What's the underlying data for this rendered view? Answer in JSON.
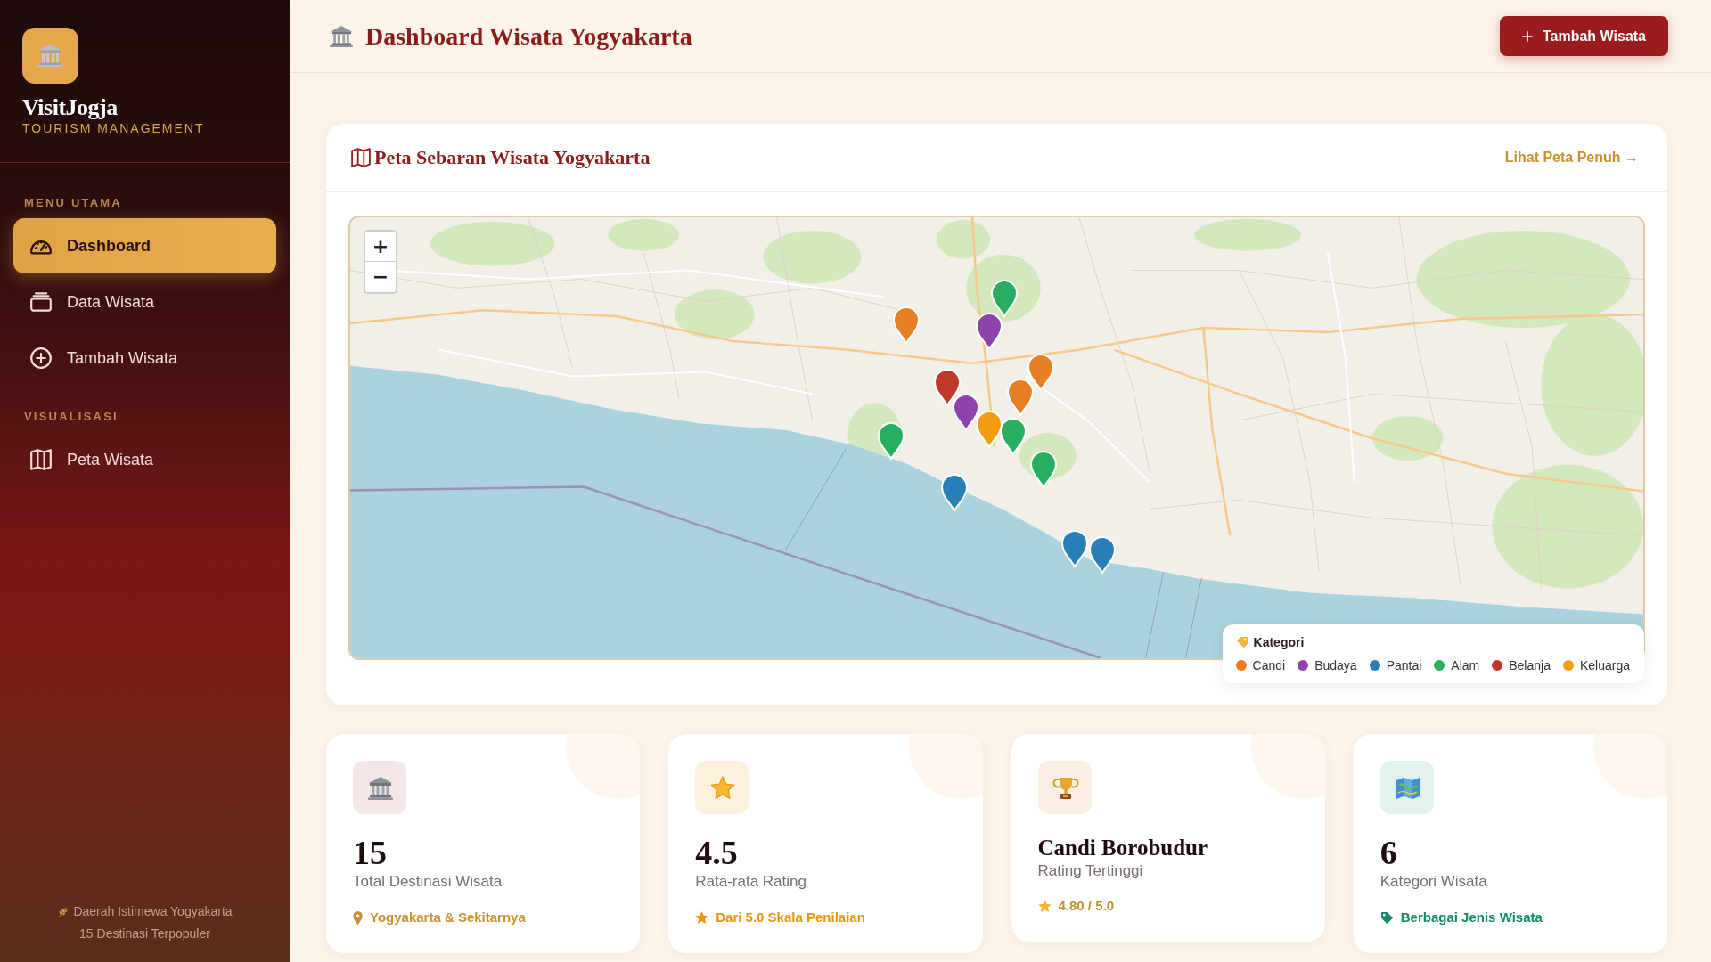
{
  "sidebar": {
    "brand": {
      "title": "VisitJogja",
      "subtitle": "TOURISM MANAGEMENT"
    },
    "sections": [
      {
        "title": "MENU UTAMA",
        "items": [
          {
            "label": "Dashboard",
            "selected": true
          },
          {
            "label": "Data Wisata",
            "selected": false
          },
          {
            "label": "Tambah Wisata",
            "selected": false
          }
        ]
      },
      {
        "title": "VISUALISASI",
        "items": [
          {
            "label": "Peta Wisata",
            "selected": false
          }
        ]
      }
    ],
    "footer": {
      "region": "Daerah Istimewa Yogyakarta",
      "note": "15 Destinasi Terpopuler"
    }
  },
  "header": {
    "title": "Dashboard Wisata Yogyakarta",
    "button": "Tambah Wisata"
  },
  "map_card": {
    "title": "Peta Sebaran Wisata Yogyakarta",
    "link": "Lihat Peta Penuh →",
    "zoom_in": "+",
    "zoom_out": "−",
    "markers": [
      {
        "color": "#27ae60"
      },
      {
        "color": "#e67e22"
      },
      {
        "color": "#8e44ad"
      },
      {
        "color": "#e67e22"
      },
      {
        "color": "#e67e22"
      },
      {
        "color": "#c0392b"
      },
      {
        "color": "#8e44ad"
      },
      {
        "color": "#f39c12"
      },
      {
        "color": "#27ae60"
      },
      {
        "color": "#27ae60"
      },
      {
        "color": "#27ae60"
      },
      {
        "color": "#2980b9"
      },
      {
        "color": "#2980b9"
      },
      {
        "color": "#2980b9"
      }
    ],
    "legend": {
      "title": "Kategori",
      "items": [
        {
          "label": "Candi",
          "color": "#e67e22"
        },
        {
          "label": "Budaya",
          "color": "#8e44ad"
        },
        {
          "label": "Pantai",
          "color": "#2980b9"
        },
        {
          "label": "Alam",
          "color": "#27ae60"
        },
        {
          "label": "Belanja",
          "color": "#c0392b"
        },
        {
          "label": "Keluarga",
          "color": "#f39c12"
        }
      ]
    }
  },
  "stats": [
    {
      "kind": "number",
      "value": "15",
      "label": "Total Destinasi Wisata",
      "note": "Yogyakarta & Sekitarnya",
      "color": "#c8912e"
    },
    {
      "kind": "number",
      "value": "4.5",
      "label": "Rata-rata Rating",
      "note": "Dari 5.0 Skala Penilaian",
      "color": "#e8960f"
    },
    {
      "kind": "name",
      "value": "Candi Borobudur",
      "label": "Rating Tertinggi",
      "note": "4.80 / 5.0",
      "color": "#c0912f"
    },
    {
      "kind": "number",
      "value": "6",
      "label": "Kategori Wisata",
      "note": "Berbagai Jenis Wisata",
      "color": "#13876a"
    }
  ]
}
